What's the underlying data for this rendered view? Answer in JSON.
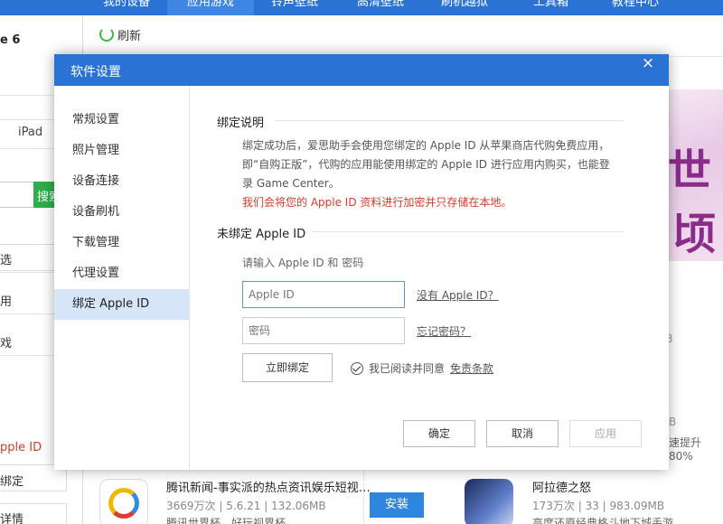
{
  "topnav": {
    "items": [
      "我的设备",
      "应用游戏",
      "铃声壁纸",
      "高清壁纸",
      "刷机越狱",
      "工具箱",
      "教程中心"
    ],
    "active_index": 1
  },
  "leftpanel": {
    "device_name": "e 6",
    "tab_ipad": "iPad",
    "search_button": "搜索",
    "items": [
      "选",
      "用",
      "戏"
    ],
    "red_item": "pple ID",
    "bind_item": "绑定",
    "detail_item": "详情"
  },
  "main": {
    "refresh_label": "刷新",
    "fragments": [
      "3",
      "B",
      "速提升80%"
    ],
    "apps": [
      {
        "title": "腾讯新闻-事实派的热点资讯娱乐短视…",
        "meta": "3669万次 | 5.6.21 | 132.06MB",
        "desc": "腾讯世界杯，好玩视界杯",
        "install": "安装"
      },
      {
        "title": "阿拉德之怒",
        "meta": "173万次 | 33 | 983.09MB",
        "desc": "高度还原经典格斗地下城手游"
      }
    ]
  },
  "dialog": {
    "title": "软件设置",
    "close": "×",
    "sidebar": [
      "常规设置",
      "照片管理",
      "设备连接",
      "设备刷机",
      "下载管理",
      "代理设置",
      "绑定 Apple ID"
    ],
    "active_index": 6,
    "bind_section": {
      "title": "绑定说明",
      "lines": [
        "绑定成功后，爱思助手会使用您绑定的 Apple ID 从苹果商店代购免费应用，",
        "即“自购正版”，代购的应用能使用绑定的 Apple ID 进行应用内购买，也能登",
        "录 Game Center。"
      ],
      "warning": "我们会将您的 Apple ID 资料进行加密并只存储在本地。"
    },
    "unbound_section": {
      "title": "未绑定 Apple ID",
      "hint": "请输入 Apple ID 和 密码",
      "appleid_placeholder": "Apple ID",
      "password_placeholder": "密码",
      "no_appleid_link": "没有 Apple ID？",
      "forgot_link": "忘记密码？",
      "bind_button": "立即绑定",
      "agree_text": "我已阅读并同意",
      "terms_link": "免责条款"
    },
    "buttons": {
      "ok": "确定",
      "cancel": "取消",
      "apply": "应用"
    }
  }
}
